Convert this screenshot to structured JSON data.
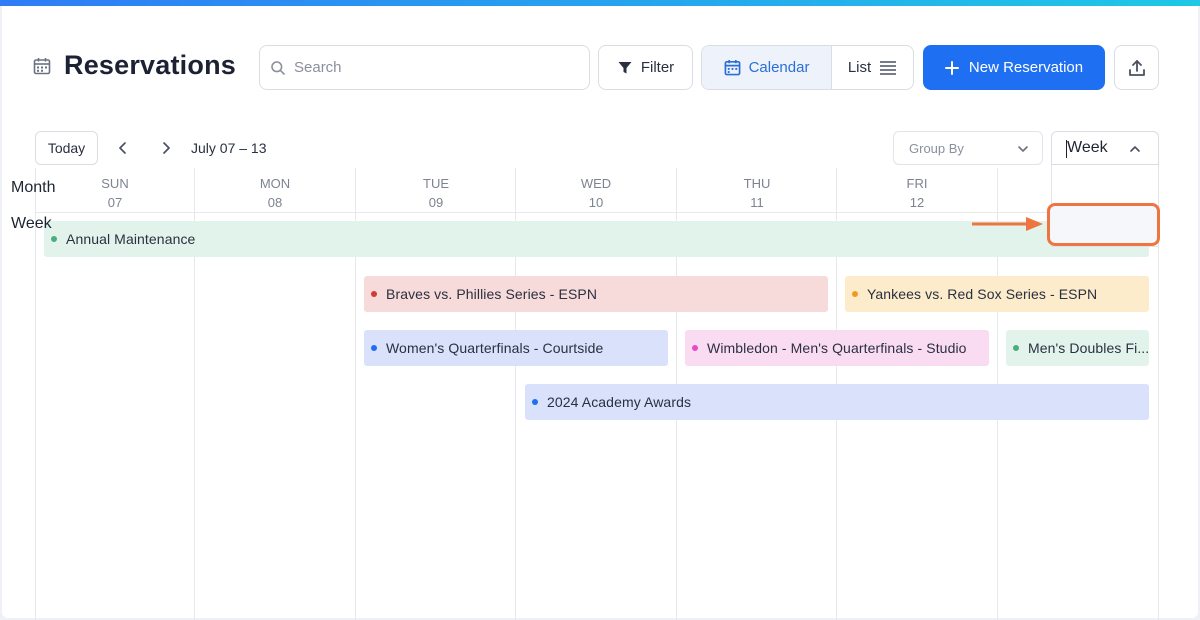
{
  "header": {
    "title": "Reservations",
    "search_placeholder": "Search",
    "filter_label": "Filter",
    "calendar_label": "Calendar",
    "list_label": "List",
    "new_label": "New Reservation"
  },
  "toolbar": {
    "today_label": "Today",
    "range_label": "July 07 – 13",
    "group_by_placeholder": "Group By",
    "view_selected": "Week"
  },
  "view_options": [
    "Month",
    "Week"
  ],
  "days": [
    {
      "dow": "SUN",
      "date": "07"
    },
    {
      "dow": "MON",
      "date": "08"
    },
    {
      "dow": "TUE",
      "date": "09"
    },
    {
      "dow": "WED",
      "date": "10"
    },
    {
      "dow": "THU",
      "date": "11"
    },
    {
      "dow": "FRI",
      "date": "12"
    }
  ],
  "events": [
    {
      "title": "Annual Maintenance",
      "color": "#49ad7e",
      "bg": "#e2f3ec"
    },
    {
      "title": "Braves vs. Phillies Series - ESPN",
      "color": "#d33a3a",
      "bg": "#f7dada"
    },
    {
      "title": "Yankees vs. Red Sox Series - ESPN",
      "color": "#f29a1d",
      "bg": "#fdeccc"
    },
    {
      "title": "Women's Quarterfinals - Courtside",
      "color": "#1f6ff2",
      "bg": "#d9e1fb"
    },
    {
      "title": "Wimbledon - Men's Quarterfinals - Studio",
      "color": "#e64ac7",
      "bg": "#fadcf2"
    },
    {
      "title": "Men's Doubles Fi...",
      "color": "#49ad7e",
      "bg": "#e2f3ec"
    },
    {
      "title": "2024 Academy Awards",
      "color": "#1f6ff2",
      "bg": "#d9e1fb"
    }
  ],
  "colors": {
    "accent": "#1f6ff2",
    "highlight": "#ee7440"
  }
}
